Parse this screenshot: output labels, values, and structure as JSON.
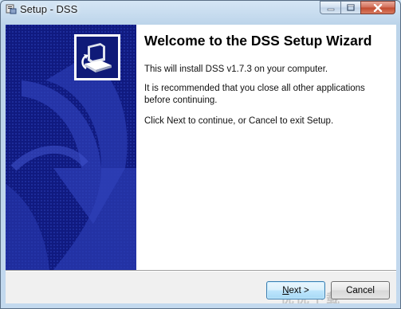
{
  "window": {
    "title": "Setup - DSS",
    "icon": "setup-installer-icon",
    "caption_buttons": [
      "minimize",
      "maximize",
      "close"
    ]
  },
  "wizard": {
    "heading": "Welcome to the DSS Setup Wizard",
    "paragraphs": [
      "This will install DSS v1.7.3 on your computer.",
      "It is recommended that you close all other applications before continuing.",
      "Click Next to continue, or Cancel to exit Setup."
    ],
    "logo_icon": "computer-installer-icon"
  },
  "buttons": {
    "next_prefix": "",
    "next_mnemonic": "N",
    "next_rest": "ext >",
    "cancel": "Cancel"
  },
  "watermark": "优优下载",
  "colors": {
    "side_panel": "#101a80",
    "titlebar": "#c3d9ee",
    "content_bg": "#ffffff"
  }
}
